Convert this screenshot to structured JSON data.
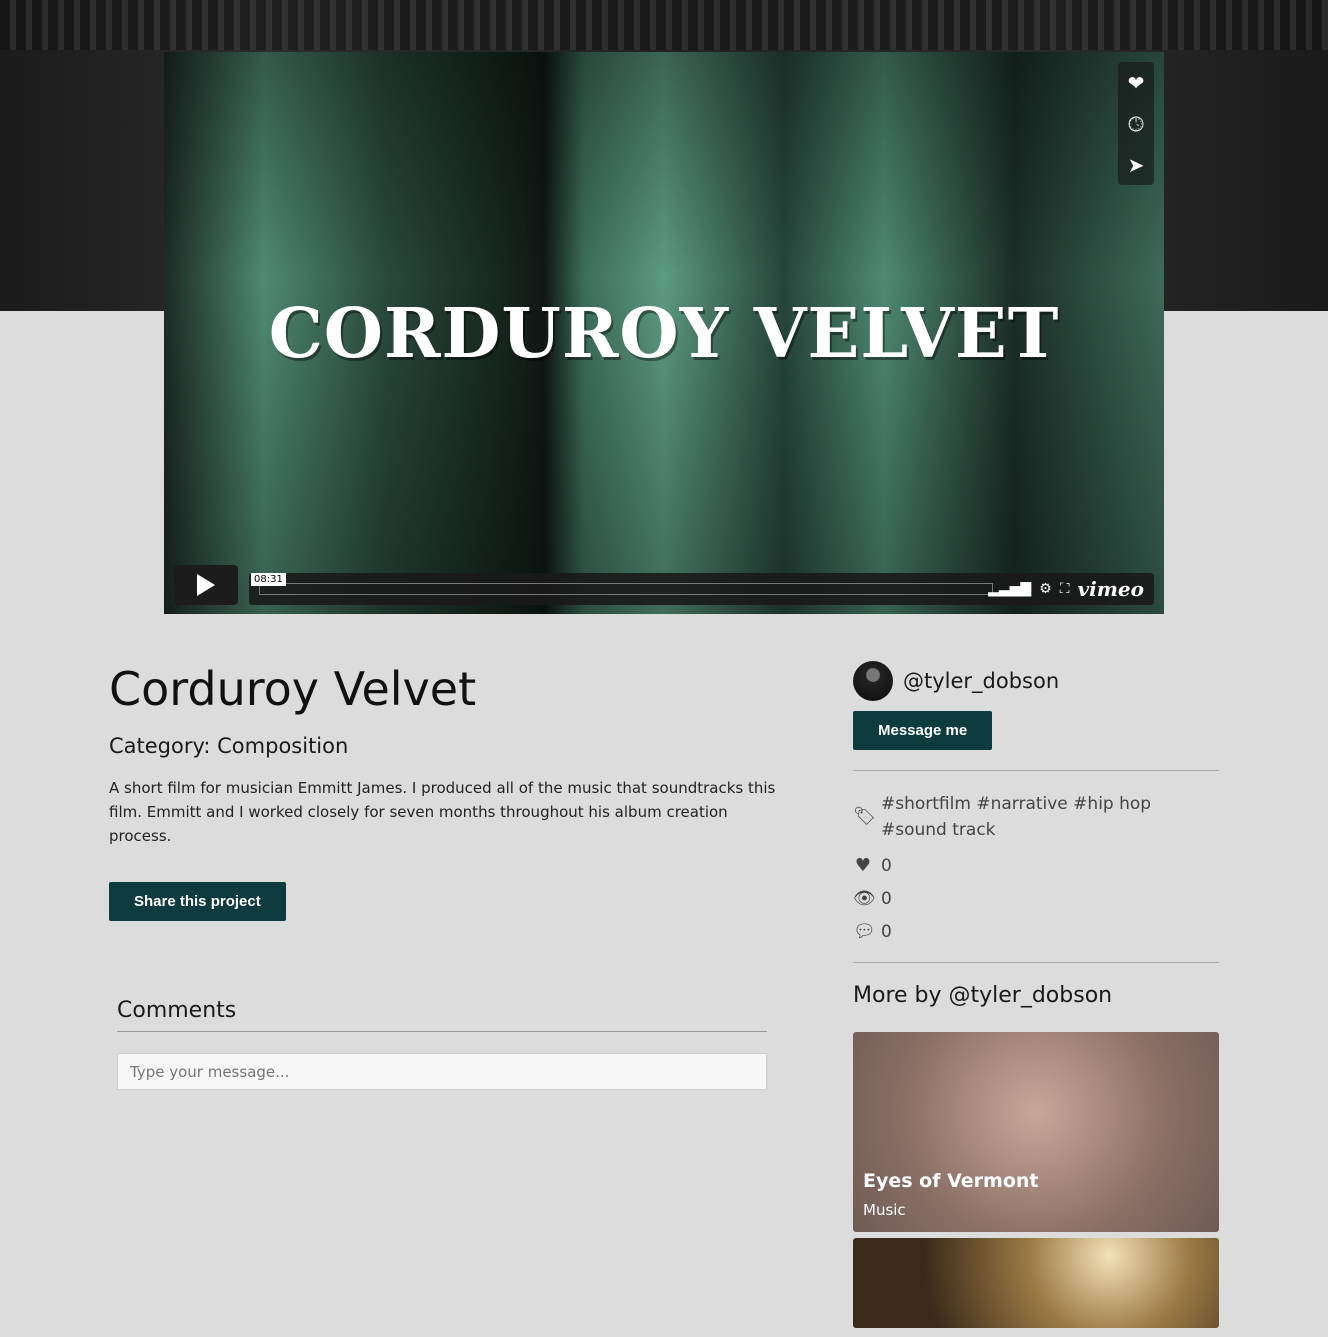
{
  "video": {
    "title": "CORDUROY VELVET",
    "time": "08:31",
    "brand": "vimeo"
  },
  "project": {
    "title": "Corduroy Velvet",
    "category": "Category: Composition",
    "description": "A short film for musician Emmitt James. I produced all of the music that soundtracks this film. Emmitt and I worked closely for seven months throughout his album creation process.",
    "share_label": "Share this project"
  },
  "comments": {
    "heading": "Comments",
    "placeholder": "Type your message..."
  },
  "author": {
    "handle": "@tyler_dobson",
    "message_label": "Message me"
  },
  "stats": {
    "tags": "#shortfilm #narrative #hip hop #sound track",
    "likes": "0",
    "views": "0",
    "comments": "0"
  },
  "more": {
    "heading": "More by @tyler_dobson",
    "cards": [
      {
        "title": "Eyes of Vermont",
        "category": "Music"
      }
    ]
  },
  "colors": {
    "accent": "#0d3b3e",
    "background": "#dcdcdc"
  }
}
